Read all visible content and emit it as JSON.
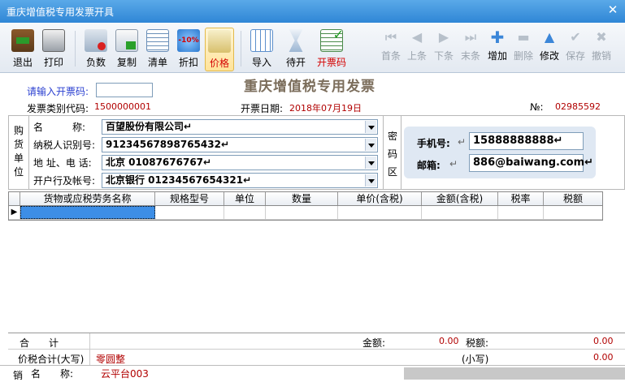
{
  "window": {
    "title": "重庆增值税专用发票开具"
  },
  "toolbar": {
    "exit": "退出",
    "print": "打印",
    "negative": "负数",
    "copy": "复制",
    "list": "清单",
    "discount": "折扣",
    "discount_badge": "-10%",
    "price": "价格",
    "import": "导入",
    "pending": "待开",
    "invoice_code": "开票码",
    "first": "首条",
    "prev": "上条",
    "next": "下条",
    "last": "末条",
    "add": "增加",
    "delete": "删除",
    "modify": "修改",
    "save": "保存",
    "undo": "撤销"
  },
  "header": {
    "code_prompt": "请输入开票码:",
    "code_value": "",
    "invoice_title": "重庆增值税专用发票",
    "category_label": "发票类别代码:",
    "category_value": "1500000001",
    "date_label": "开票日期:",
    "date_value": "2018年07月19日",
    "no_label": "№:",
    "no_value": "02985592"
  },
  "buyer": {
    "section_label": [
      "购",
      "货",
      "单",
      "位"
    ],
    "name_label": "名　　　称:",
    "name_value": "百望股份有限公司↵",
    "taxid_label": "纳税人识别号:",
    "taxid_value": "91234567898765432↵",
    "address_label": "地 址、电 话:",
    "address_value": "北京 01087676767↵",
    "bank_label": "开户行及帐号:",
    "bank_value": "北京银行 01234567654321↵",
    "password_label": [
      "密",
      "码",
      "区"
    ]
  },
  "contact": {
    "phone_label": "手机号:",
    "phone_mark": "↵",
    "phone_value": "15888888888↵",
    "email_label": "邮箱:",
    "email_mark": "↵",
    "email_value": "886@baiwang.com↵"
  },
  "grid": {
    "columns": [
      "货物或应税劳务名称",
      "规格型号",
      "单位",
      "数量",
      "单价(含税)",
      "金额(含税)",
      "税率",
      "税额"
    ],
    "row_marker": "▶"
  },
  "summary": {
    "total_label": "合　　计",
    "amount_label": "金额:",
    "amount_value": "0.00",
    "tax_label": "税额:",
    "tax_value": "0.00",
    "total_cn_label": "价税合计(大写)",
    "total_cn_value": "零圆整",
    "small_label": "(小写)",
    "small_value": "0.00"
  },
  "seller": {
    "section_label": "销",
    "name_label": "名　　称:",
    "name_value": "云平台003"
  }
}
